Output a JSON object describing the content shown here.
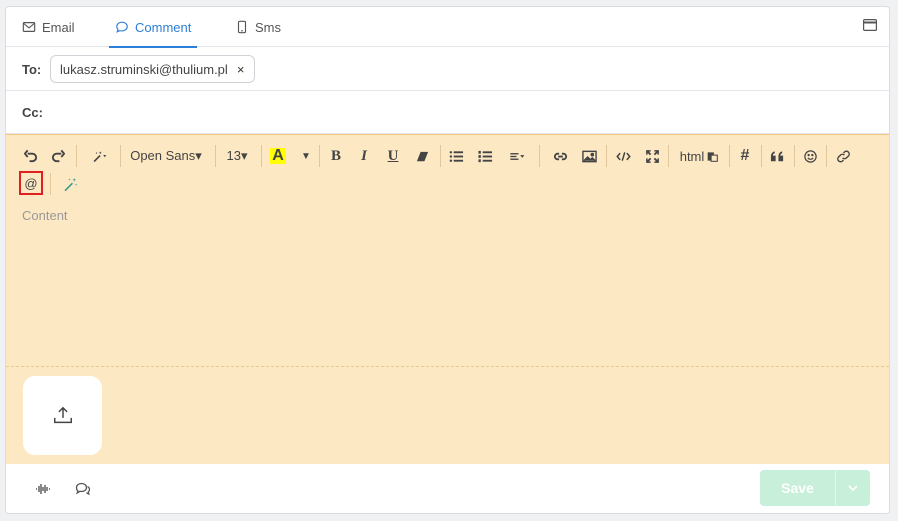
{
  "tabs": [
    {
      "label": "Email",
      "icon": "mail-icon"
    },
    {
      "label": "Comment",
      "icon": "comment-icon",
      "active": true
    },
    {
      "label": "Sms",
      "icon": "phone-icon"
    }
  ],
  "to": {
    "label": "To:",
    "chips": [
      {
        "value": "lukasz.struminski@thulium.pl",
        "remove": "×"
      }
    ]
  },
  "cc": {
    "label": "Cc:",
    "value": ""
  },
  "toolbar": {
    "font_family": "Open Sans▾",
    "font_size": "13▾",
    "html_label": "html",
    "mention_label": "@",
    "hash_label": "#",
    "bold_label": "B",
    "italic_label": "I",
    "underline_label": "U",
    "color_label": "A",
    "highlight_color": "#ffff00"
  },
  "editor": {
    "placeholder": "Content"
  },
  "footer": {
    "save_label": "Save"
  },
  "colors": {
    "accent": "#2c7fd6",
    "editor_bg": "#fde8c4",
    "save_bg": "#c7efd9",
    "mention_border": "#e02020"
  }
}
